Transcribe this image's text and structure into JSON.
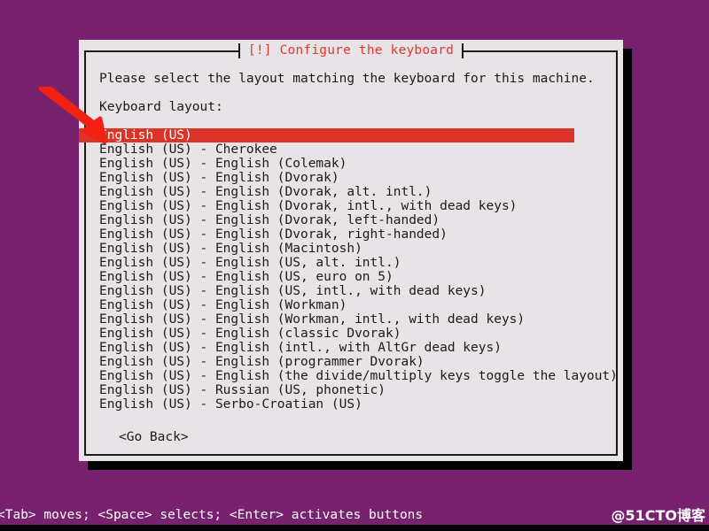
{
  "colors": {
    "desktop_background": "#77216F",
    "dialog_background": "#E7E3E6",
    "dialog_border": "#1A1A1A",
    "title_accent": "#DF382C",
    "selection_highlight": "#DB3328",
    "selection_text": "#FFFFFF",
    "shadow": "#000000",
    "annotation_arrow": "#F32114",
    "status_text": "#FFFFFF"
  },
  "dialog": {
    "title": "[!] Configure the keyboard",
    "prompt": "Please select the layout matching the keyboard for this machine.",
    "field_label": "Keyboard layout:",
    "go_back_button": "<Go Back>",
    "selected_index": 0,
    "layouts": [
      "English (US)",
      "English (US) - Cherokee",
      "English (US) - English (Colemak)",
      "English (US) - English (Dvorak)",
      "English (US) - English (Dvorak, alt. intl.)",
      "English (US) - English (Dvorak, intl., with dead keys)",
      "English (US) - English (Dvorak, left-handed)",
      "English (US) - English (Dvorak, right-handed)",
      "English (US) - English (Macintosh)",
      "English (US) - English (US, alt. intl.)",
      "English (US) - English (US, euro on 5)",
      "English (US) - English (US, intl., with dead keys)",
      "English (US) - English (Workman)",
      "English (US) - English (Workman, intl., with dead keys)",
      "English (US) - English (classic Dvorak)",
      "English (US) - English (intl., with AltGr dead keys)",
      "English (US) - English (programmer Dvorak)",
      "English (US) - English (the divide/multiply keys toggle the layout)",
      "English (US) - Russian (US, phonetic)",
      "English (US) - Serbo-Croatian (US)"
    ]
  },
  "statusbar": {
    "help_text": "<Tab> moves; <Space> selects; <Enter> activates buttons",
    "watermark": "@51CTO博客"
  },
  "annotation": {
    "icon": "arrow-pointing-down-right",
    "target": "English (US)"
  }
}
